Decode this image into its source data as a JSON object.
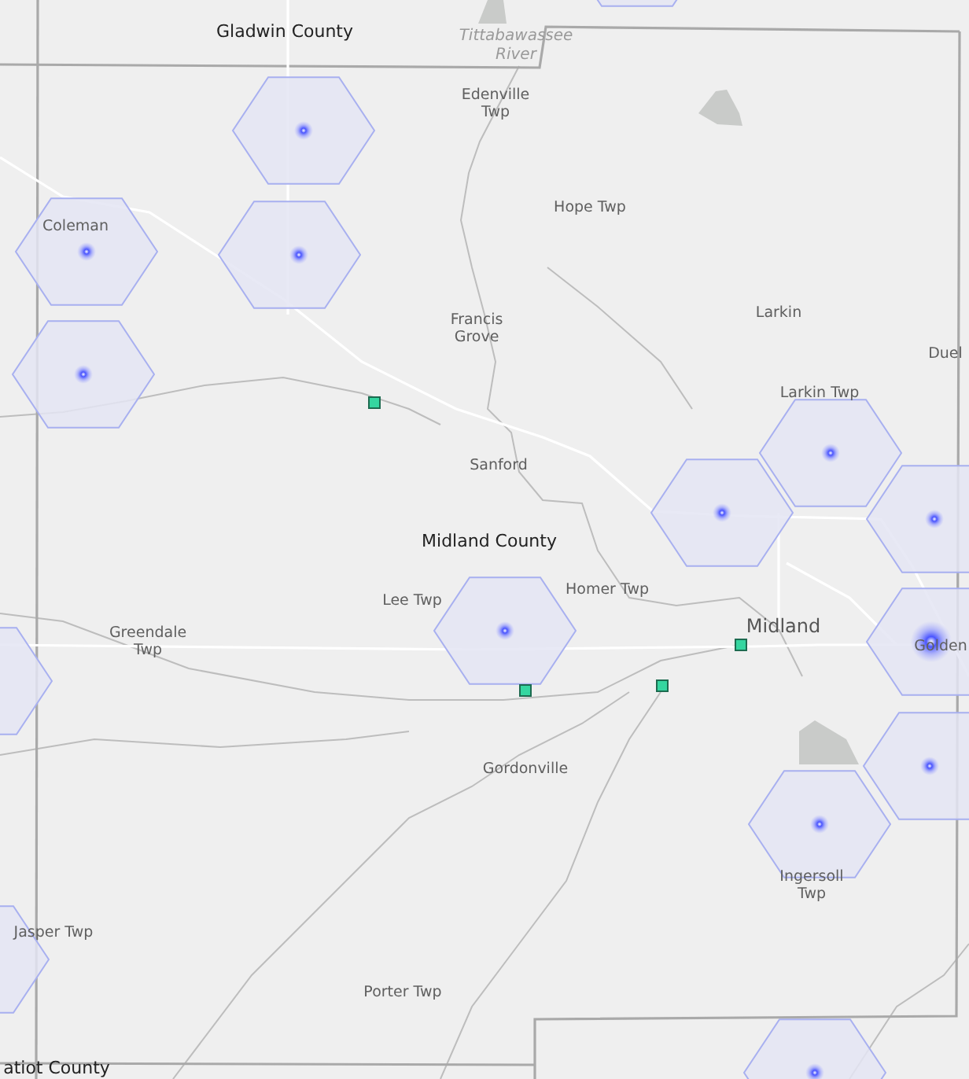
{
  "map": {
    "labels": [
      {
        "text": "Gladwin County",
        "kind": "county"
      },
      {
        "text": "Tittabawassee River",
        "kind": "water"
      },
      {
        "text": "Edenville Twp",
        "kind": "place"
      },
      {
        "text": "Hope Twp",
        "kind": "place"
      },
      {
        "text": "Coleman",
        "kind": "place"
      },
      {
        "text": "Larkin",
        "kind": "place"
      },
      {
        "text": "Duel",
        "kind": "place"
      },
      {
        "text": "Francis Grove",
        "kind": "place"
      },
      {
        "text": "Larkin Twp",
        "kind": "place"
      },
      {
        "text": "Sanford",
        "kind": "place"
      },
      {
        "text": "Midland County",
        "kind": "county"
      },
      {
        "text": "Lee Twp",
        "kind": "place"
      },
      {
        "text": "Homer Twp",
        "kind": "place"
      },
      {
        "text": "Greendale Twp",
        "kind": "place"
      },
      {
        "text": "Midland",
        "kind": "city"
      },
      {
        "text": "Golden",
        "kind": "place"
      },
      {
        "text": "Gordonville",
        "kind": "place"
      },
      {
        "text": "Ingersoll Twp",
        "kind": "place"
      },
      {
        "text": "Jasper Twp",
        "kind": "place"
      },
      {
        "text": "Porter Twp",
        "kind": "place"
      },
      {
        "text": "atiot County",
        "kind": "county"
      }
    ]
  }
}
